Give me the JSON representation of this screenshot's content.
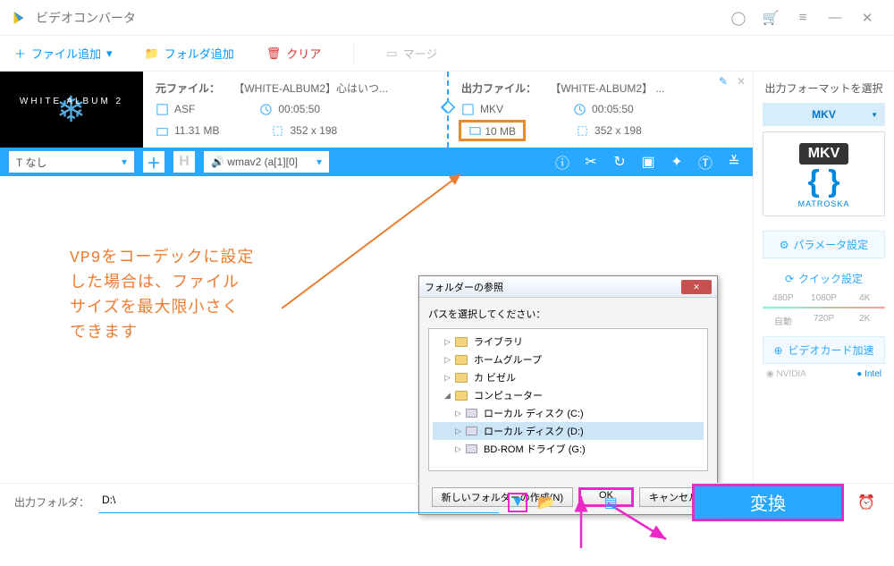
{
  "app": {
    "title": "ビデオコンバータ"
  },
  "toolbar": {
    "addFile": "ファイル追加",
    "addFolder": "フォルダ追加",
    "clear": "クリア",
    "merge": "マージ"
  },
  "item": {
    "src": {
      "label": "元ファイル：",
      "name": "【WHITE-ALBUM2】心はいつ...",
      "format": "ASF",
      "duration": "00:05:50",
      "size": "11.31 MB",
      "dims": "352 x 198"
    },
    "out": {
      "label": "出力ファイル：",
      "name": "【WHITE-ALBUM2】 ...",
      "format": "MKV",
      "duration": "00:05:50",
      "size": "10 MB",
      "dims": "352 x 198"
    }
  },
  "editbar": {
    "subtitle": "なし",
    "audio": "wmav2 (a[1][0]"
  },
  "thumblabel": "WHITE ALBUM 2",
  "annotation": "VP9をコーデックに設定\nした場合は、ファイル\nサイズを最大限小さく\nできます",
  "dialog": {
    "title": "フォルダーの参照",
    "prompt": "パスを選択してください：",
    "tree": [
      {
        "label": "ライブラリ",
        "depth": 1,
        "exp": "▷",
        "icon": "f"
      },
      {
        "label": "ホームグループ",
        "depth": 1,
        "exp": "▷",
        "icon": "f"
      },
      {
        "label": "カ ビゼル",
        "depth": 1,
        "exp": "▷",
        "icon": "f"
      },
      {
        "label": "コンピューター",
        "depth": 1,
        "exp": "◢",
        "icon": "f"
      },
      {
        "label": "ローカル ディスク (C:)",
        "depth": 2,
        "exp": "▷",
        "icon": "d"
      },
      {
        "label": "ローカル ディスク (D:)",
        "depth": 2,
        "exp": "▷",
        "icon": "d",
        "sel": true
      },
      {
        "label": "BD-ROM ドライブ (G:)",
        "depth": 2,
        "exp": "▷",
        "icon": "d"
      }
    ],
    "newFolder": "新しいフォルダーの作成(N)",
    "ok": "OK",
    "cancel": "キャンセル"
  },
  "footer": {
    "label": "出力フォルダ：",
    "path": "D:\\",
    "convert": "変換"
  },
  "right": {
    "head": "出力フォーマットを選択",
    "format": "MKV",
    "badge": "MKV",
    "matroska": "MATROSKA",
    "paramLink": "パラメータ設定",
    "quick": "クイック設定",
    "scaleTop": [
      "480P",
      "1080P",
      "4K"
    ],
    "scaleBot": [
      "自動",
      "720P",
      "2K"
    ],
    "gpu": "ビデオカード加速",
    "nvidia": "NVIDIA",
    "intel": "Intel"
  }
}
